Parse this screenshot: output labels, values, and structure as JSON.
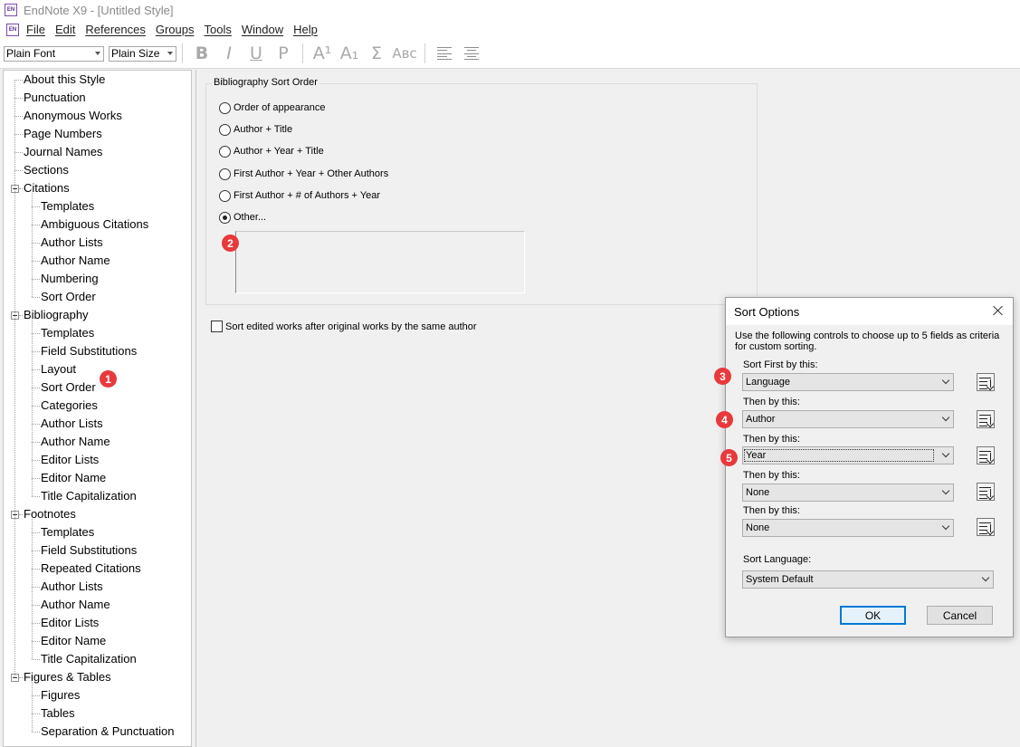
{
  "window": {
    "title": "EndNote X9 - [Untitled Style]",
    "logo_text": "EN"
  },
  "menu": [
    "File",
    "Edit",
    "References",
    "Groups",
    "Tools",
    "Window",
    "Help"
  ],
  "toolbar": {
    "font": "Plain Font",
    "size": "Plain Size",
    "format_buttons": [
      "B",
      "I",
      "U",
      "P",
      "A¹",
      "A₁",
      "Σ",
      "Aʙᴄ"
    ]
  },
  "tree": [
    {
      "label": "About this Style",
      "level": 0
    },
    {
      "label": "Punctuation",
      "level": 0
    },
    {
      "label": "Anonymous Works",
      "level": 0
    },
    {
      "label": "Page Numbers",
      "level": 0
    },
    {
      "label": "Journal Names",
      "level": 0
    },
    {
      "label": "Sections",
      "level": 0
    },
    {
      "label": "Citations",
      "level": 0,
      "expanded": true
    },
    {
      "label": "Templates",
      "level": 1
    },
    {
      "label": "Ambiguous Citations",
      "level": 1
    },
    {
      "label": "Author Lists",
      "level": 1
    },
    {
      "label": "Author Name",
      "level": 1
    },
    {
      "label": "Numbering",
      "level": 1
    },
    {
      "label": "Sort Order",
      "level": 1
    },
    {
      "label": "Bibliography",
      "level": 0,
      "expanded": true
    },
    {
      "label": "Templates",
      "level": 1
    },
    {
      "label": "Field Substitutions",
      "level": 1
    },
    {
      "label": "Layout",
      "level": 1
    },
    {
      "label": "Sort Order",
      "level": 1,
      "selected": true
    },
    {
      "label": "Categories",
      "level": 1
    },
    {
      "label": "Author Lists",
      "level": 1
    },
    {
      "label": "Author Name",
      "level": 1
    },
    {
      "label": "Editor Lists",
      "level": 1
    },
    {
      "label": "Editor Name",
      "level": 1
    },
    {
      "label": "Title Capitalization",
      "level": 1
    },
    {
      "label": "Footnotes",
      "level": 0,
      "expanded": true
    },
    {
      "label": "Templates",
      "level": 1
    },
    {
      "label": "Field Substitutions",
      "level": 1
    },
    {
      "label": "Repeated Citations",
      "level": 1
    },
    {
      "label": "Author Lists",
      "level": 1
    },
    {
      "label": "Author Name",
      "level": 1
    },
    {
      "label": "Editor Lists",
      "level": 1
    },
    {
      "label": "Editor Name",
      "level": 1
    },
    {
      "label": "Title Capitalization",
      "level": 1
    },
    {
      "label": "Figures & Tables",
      "level": 0,
      "expanded": true
    },
    {
      "label": "Figures",
      "level": 1
    },
    {
      "label": "Tables",
      "level": 1
    },
    {
      "label": "Separation & Punctuation",
      "level": 1
    }
  ],
  "sort_order": {
    "group_title": "Bibliography Sort Order",
    "options": [
      "Order of appearance",
      "Author + Title",
      "Author + Year + Title",
      "First Author + Year + Other Authors",
      "First Author + # of Authors + Year",
      "Other..."
    ],
    "selected_index": 5,
    "checkbox_label": "Sort edited works after original works by the same author"
  },
  "dialog": {
    "title": "Sort Options",
    "instructions": "Use the following controls to choose up to 5 fields as criteria for custom sorting.",
    "fields": [
      {
        "label": "Sort First by this:",
        "value": "Language"
      },
      {
        "label": "Then by this:",
        "value": "Author"
      },
      {
        "label": "Then by this:",
        "value": "Year"
      },
      {
        "label": "Then by this:",
        "value": "None"
      },
      {
        "label": "Then by this:",
        "value": "None"
      }
    ],
    "sort_language_label": "Sort Language:",
    "sort_language_value": "System Default",
    "ok_label": "OK",
    "cancel_label": "Cancel"
  },
  "badges": [
    "1",
    "2",
    "3",
    "4",
    "5"
  ],
  "colors": {
    "badge": "#e8393c",
    "default_button_border": "#0078d7"
  }
}
